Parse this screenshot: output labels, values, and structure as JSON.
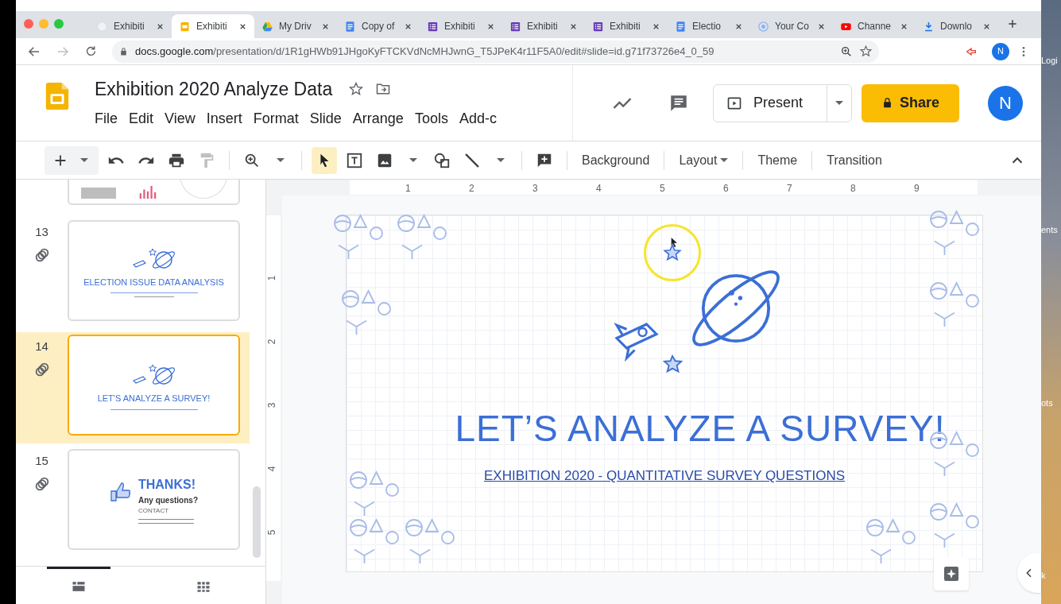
{
  "browser": {
    "tabs": [
      {
        "title": "Exhibiti",
        "kind": "blank",
        "selected": false
      },
      {
        "title": "Exhibiti",
        "kind": "slides",
        "selected": true
      },
      {
        "title": "My Driv",
        "kind": "drive",
        "selected": false
      },
      {
        "title": "Copy of",
        "kind": "docs",
        "selected": false
      },
      {
        "title": "Exhibiti",
        "kind": "forms",
        "selected": false
      },
      {
        "title": "Exhibiti",
        "kind": "forms",
        "selected": false
      },
      {
        "title": "Exhibiti",
        "kind": "forms",
        "selected": false
      },
      {
        "title": "Electio",
        "kind": "docs",
        "selected": false
      },
      {
        "title": "Your Co",
        "kind": "target",
        "selected": false
      },
      {
        "title": "Channe",
        "kind": "video",
        "selected": false
      },
      {
        "title": "Downlo",
        "kind": "download",
        "selected": false
      }
    ],
    "url_host": "docs.google.com",
    "url_path": "/presentation/d/1R1gHWb91JHgoKyFTCKVdNcMHJwnG_T5JPeK4r11F5A0/edit#slide=id.g71f73726e4_0_59",
    "profile": "N"
  },
  "document": {
    "title": "Exhibition 2020 Analyze Data",
    "menu": [
      "File",
      "Edit",
      "View",
      "Insert",
      "Format",
      "Slide",
      "Arrange",
      "Tools",
      "Add-c"
    ]
  },
  "header_actions": {
    "present": "Present",
    "share": "Share",
    "avatar": "N"
  },
  "toolbar": {
    "buttons": [
      {
        "label": "Background",
        "dropdown": false
      },
      {
        "label": "Layout",
        "dropdown": true
      },
      {
        "label": "Theme",
        "dropdown": false
      },
      {
        "label": "Transition",
        "dropdown": false
      }
    ]
  },
  "filmstrip": {
    "slides": [
      {
        "number": "13",
        "kind": "title",
        "selected": false,
        "title": "ELECTION ISSUE DATA ANALYSIS"
      },
      {
        "number": "14",
        "kind": "title",
        "selected": true,
        "title": "LET'S ANALYZE A SURVEY!"
      },
      {
        "number": "15",
        "kind": "thanks",
        "selected": false,
        "title": "THANKS!",
        "subtitle": "Any questions?",
        "label": "CONTACT"
      }
    ],
    "views": [
      {
        "kind": "list",
        "selected": true
      },
      {
        "kind": "grid",
        "selected": false
      }
    ]
  },
  "ruler": {
    "horizontal": [
      "1",
      "2",
      "3",
      "4",
      "5",
      "6",
      "7",
      "8",
      "9"
    ],
    "vertical": [
      "1",
      "2",
      "3",
      "4",
      "5"
    ]
  },
  "slide": {
    "title": "LET’S ANALYZE A SURVEY!",
    "subtitle": "EXHIBITION 2020 - QUANTITATIVE SURVEY QUESTIONS"
  },
  "desktop_labels": [
    "Logi",
    "ents",
    "ots",
    "k"
  ]
}
